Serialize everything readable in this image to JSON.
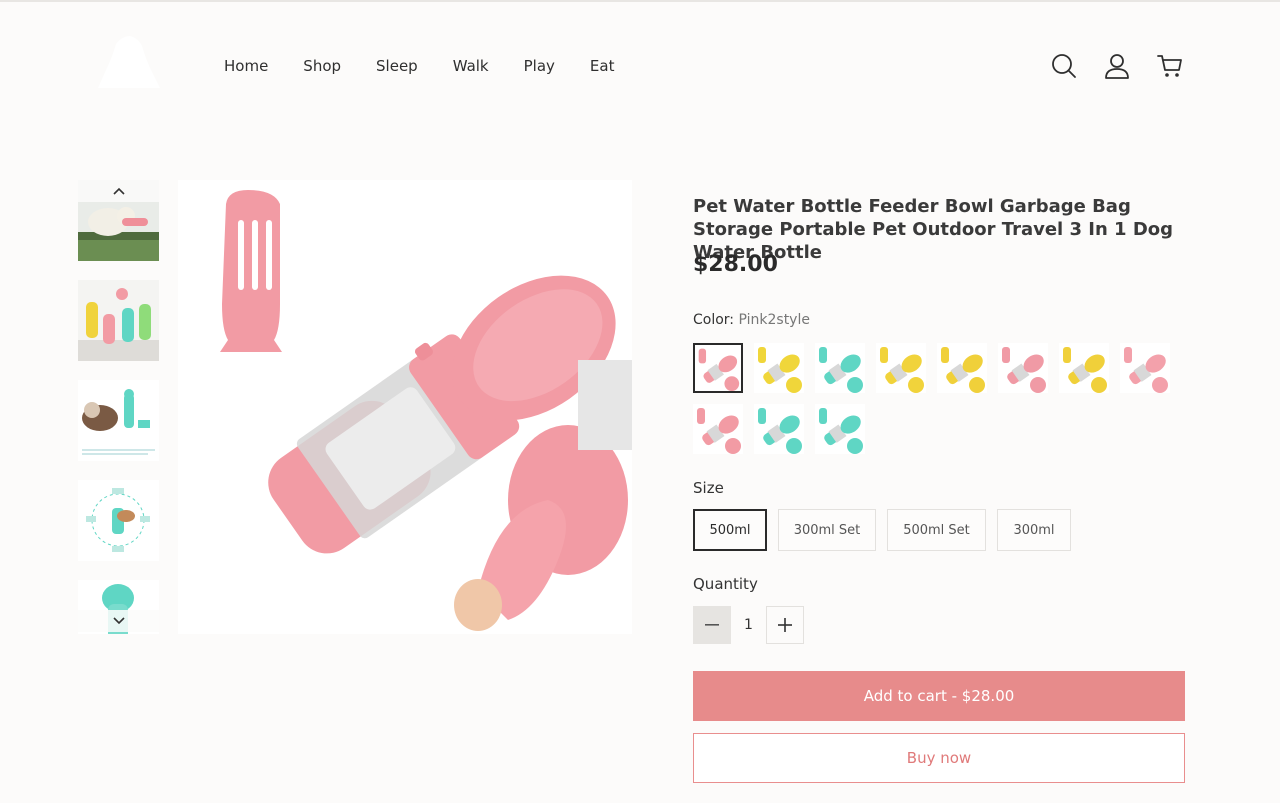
{
  "header": {
    "nav": [
      "Home",
      "Shop",
      "Sleep",
      "Walk",
      "Play",
      "Eat"
    ],
    "icons": [
      "search-icon",
      "account-icon",
      "cart-icon"
    ]
  },
  "gallery": {
    "thumbnails": [
      "dog-drinking",
      "bottles-lineup",
      "dog-with-bottle",
      "feature-diagram",
      "teal-bottle"
    ]
  },
  "product": {
    "title": "Pet Water Bottle Feeder Bowl Garbage Bag Storage Portable Pet Outdoor Travel 3 In 1 Dog Water Bottle",
    "price": "$28.00",
    "color_label": "Color:",
    "color_value": "Pink2style",
    "swatch_colors": [
      "#f29ba4",
      "#f0d63a",
      "#5fd6c4",
      "#f1d33b",
      "#f0d03a",
      "#f09aa5",
      "#f0d03a",
      "#f3a1ab",
      "#f29ba4",
      "#5fd6c4",
      "#5fd6c4"
    ],
    "size_label": "Size",
    "sizes": [
      "500ml",
      "300ml Set",
      "500ml Set",
      "300ml"
    ],
    "selected_size": "500ml",
    "quantity_label": "Quantity",
    "quantity": "1",
    "add_to_cart": "Add to cart - $28.00",
    "buy_now": "Buy now"
  },
  "colors": {
    "accent": "#e78b8b",
    "buy_border": "#e98e8e",
    "background": "#fcfbfa"
  }
}
